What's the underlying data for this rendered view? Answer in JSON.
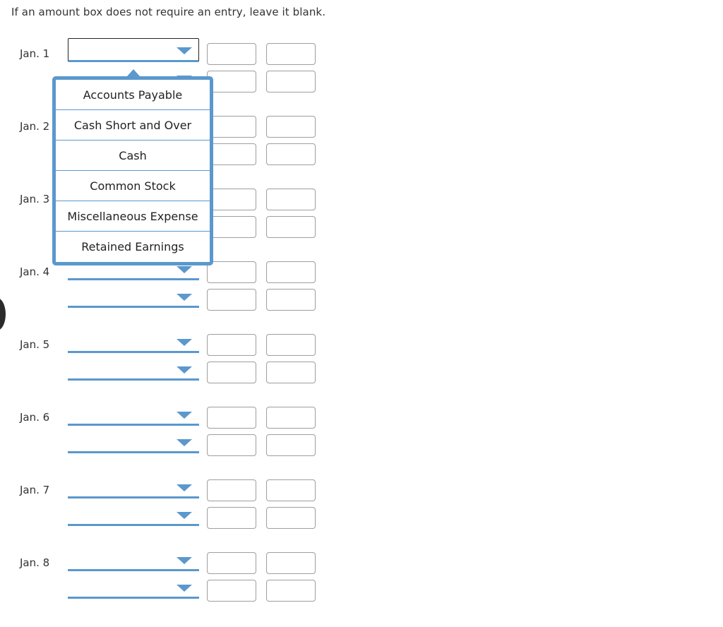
{
  "instruction": "If an amount box does not require an entry, leave it blank.",
  "accent_color": "#5a98cd",
  "entries": [
    {
      "date": "Jan. 1",
      "rows": [
        {
          "account": "",
          "debit": "",
          "credit": ""
        },
        {
          "account": "",
          "debit": "",
          "credit": ""
        }
      ]
    },
    {
      "date": "Jan. 2",
      "rows": [
        {
          "account": "",
          "debit": "",
          "credit": ""
        },
        {
          "account": "",
          "debit": "",
          "credit": ""
        }
      ]
    },
    {
      "date": "Jan. 3",
      "rows": [
        {
          "account": "",
          "debit": "",
          "credit": ""
        },
        {
          "account": "",
          "debit": "",
          "credit": ""
        }
      ]
    },
    {
      "date": "Jan. 4",
      "rows": [
        {
          "account": "",
          "debit": "",
          "credit": ""
        },
        {
          "account": "",
          "debit": "",
          "credit": ""
        }
      ]
    },
    {
      "date": "Jan. 5",
      "rows": [
        {
          "account": "",
          "debit": "",
          "credit": ""
        },
        {
          "account": "",
          "debit": "",
          "credit": ""
        }
      ]
    },
    {
      "date": "Jan. 6",
      "rows": [
        {
          "account": "",
          "debit": "",
          "credit": ""
        },
        {
          "account": "",
          "debit": "",
          "credit": ""
        }
      ]
    },
    {
      "date": "Jan. 7",
      "rows": [
        {
          "account": "",
          "debit": "",
          "credit": ""
        },
        {
          "account": "",
          "debit": "",
          "credit": ""
        }
      ]
    },
    {
      "date": "Jan. 8",
      "rows": [
        {
          "account": "",
          "debit": "",
          "credit": ""
        },
        {
          "account": "",
          "debit": "",
          "credit": ""
        }
      ]
    }
  ],
  "dropdown": {
    "open_for": "Jan. 1 row 1",
    "options": [
      "Accounts Payable",
      "Cash Short and Over",
      "Cash",
      "Common Stock",
      "Miscellaneous Expense",
      "Retained Earnings"
    ]
  }
}
